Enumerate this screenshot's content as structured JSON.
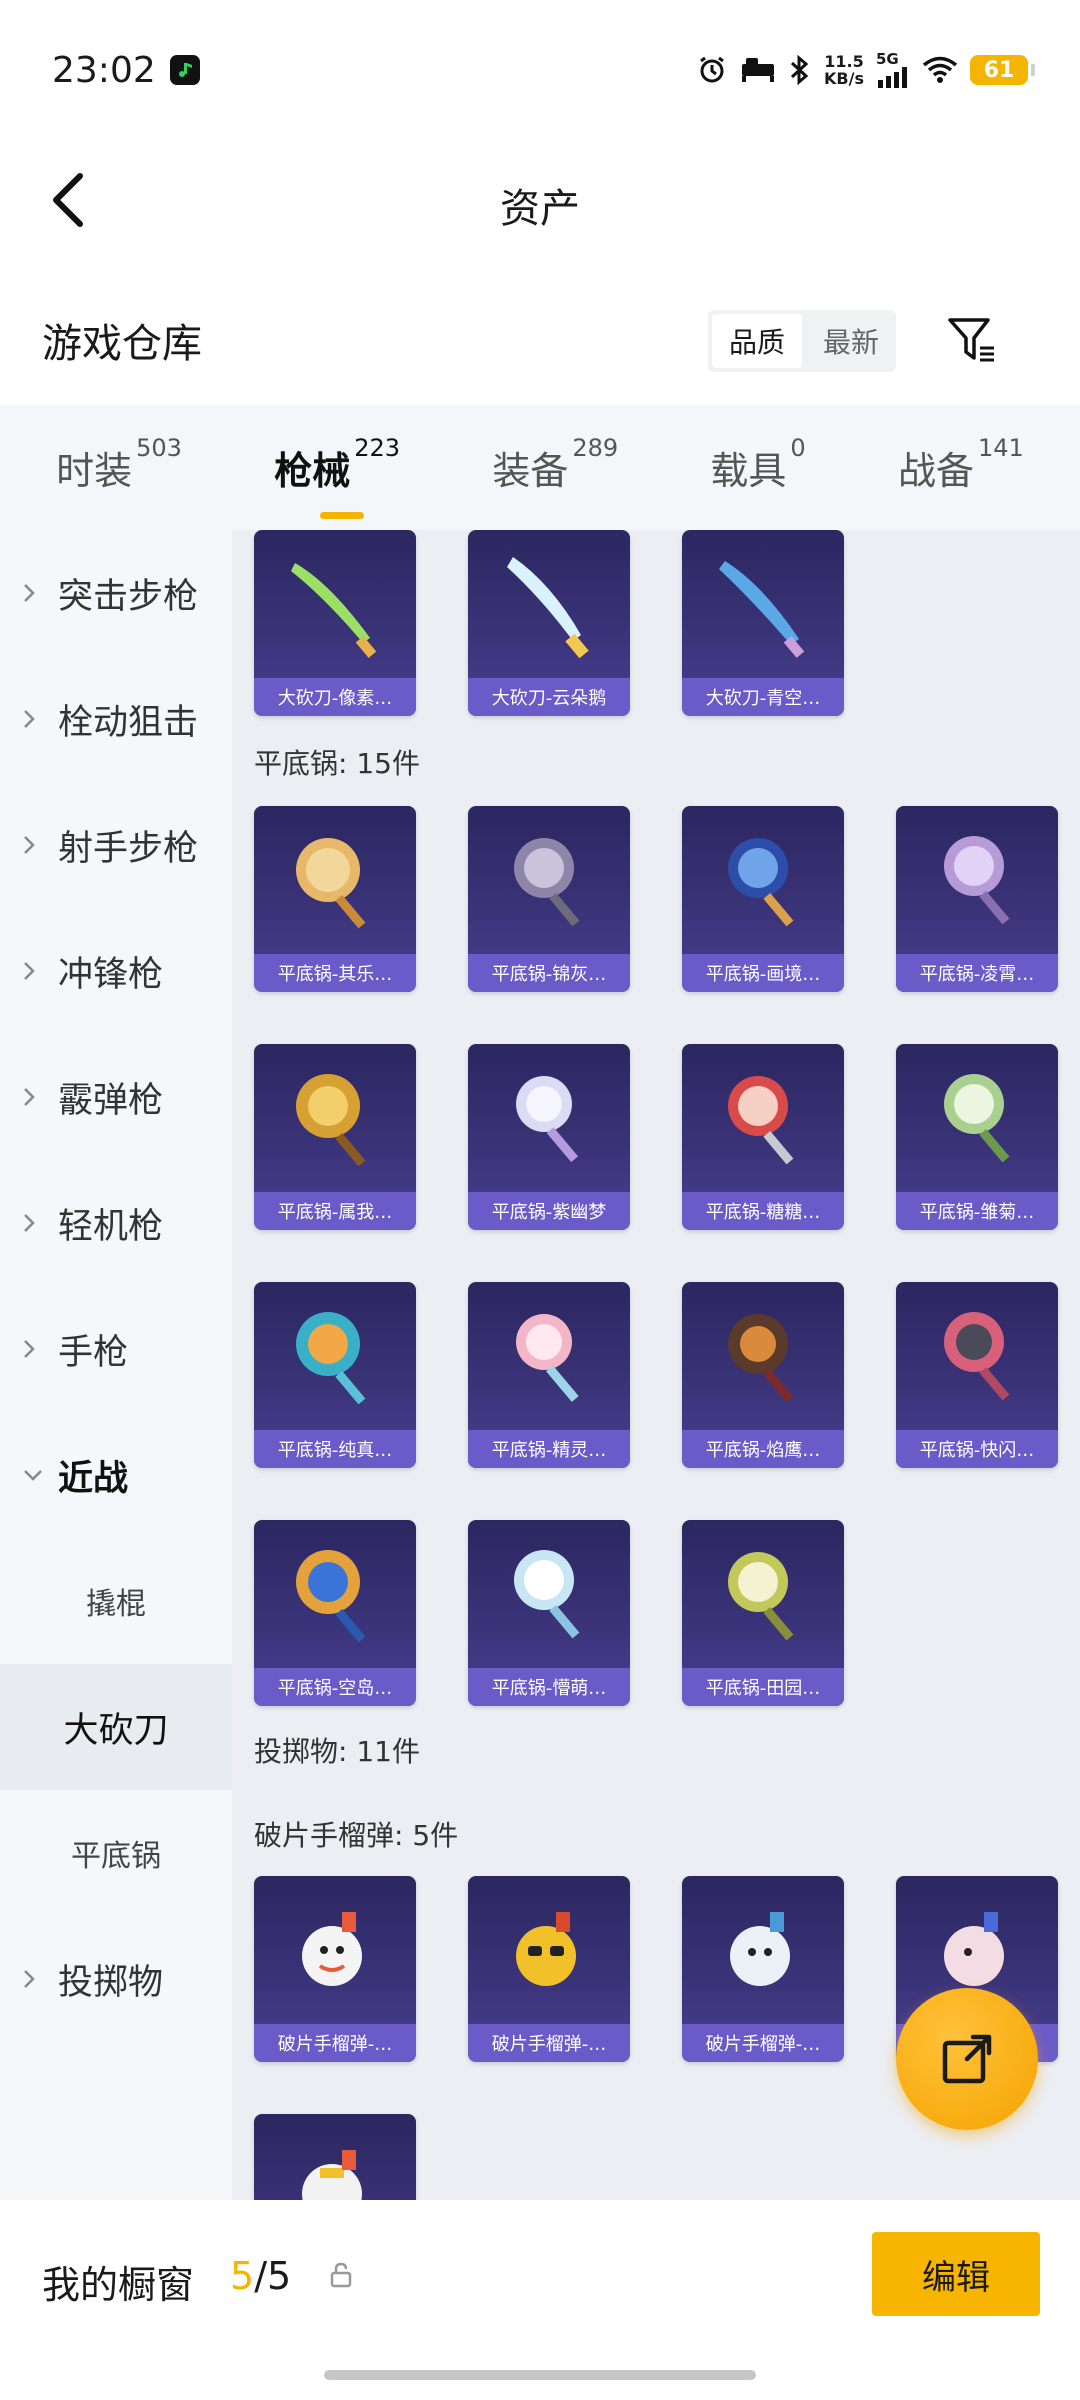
{
  "status_bar": {
    "time": "23:02",
    "net_speed_value": "11.5",
    "net_speed_unit": "KB/s",
    "network": "5G",
    "battery": "61",
    "icons": [
      "alarm-icon",
      "sleep-icon",
      "bluetooth-icon",
      "signal-icon",
      "wifi-icon"
    ]
  },
  "header": {
    "title": "资产"
  },
  "warehouse": {
    "title": "游戏仓库",
    "sort_options": [
      "品质",
      "最新"
    ],
    "active_sort": "品质"
  },
  "tabs": [
    {
      "label": "时装",
      "count": "503"
    },
    {
      "label": "枪械",
      "count": "223",
      "active": true
    },
    {
      "label": "装备",
      "count": "289"
    },
    {
      "label": "载具",
      "count": "0"
    },
    {
      "label": "战备",
      "count": "141"
    }
  ],
  "sidebar": {
    "items": [
      {
        "label": "突击步枪"
      },
      {
        "label": "栓动狙击"
      },
      {
        "label": "射手步枪"
      },
      {
        "label": "冲锋枪"
      },
      {
        "label": "霰弹枪"
      },
      {
        "label": "轻机枪"
      },
      {
        "label": "手枪"
      },
      {
        "label": "近战"
      }
    ],
    "subitems": [
      {
        "label": "撬棍"
      },
      {
        "label": "大砍刀"
      },
      {
        "label": "平底锅"
      }
    ],
    "last_item": {
      "label": "投掷物"
    }
  },
  "content": {
    "machete_items": [
      "大砍刀-像素…",
      "大砍刀-云朵鹅",
      "大砍刀-青空…"
    ],
    "pan_label": "平底锅: 15件",
    "pan_items": [
      "平底锅-其乐…",
      "平底锅-锦灰…",
      "平底锅-画境…",
      "平底锅-凌霄…",
      "平底锅-属我…",
      "平底锅-紫幽梦",
      "平底锅-糖糖…",
      "平底锅-雏菊…",
      "平底锅-纯真…",
      "平底锅-精灵…",
      "平底锅-焰鹰…",
      "平底锅-快闪…",
      "平底锅-空岛…",
      "平底锅-懵萌…",
      "平底锅-田园…"
    ],
    "throwable_label": "投掷物: 11件",
    "grenade_label": "破片手榴弹: 5件",
    "grenade_items": [
      "破片手榴弹-…",
      "破片手榴弹-…",
      "破片手榴弹-…",
      "…"
    ]
  },
  "bottom_bar": {
    "label": "我的橱窗",
    "count_current": "5",
    "count_separator": "/",
    "count_total": "5",
    "edit_label": "编辑"
  },
  "colors": {
    "accent": "#f5b400",
    "card_bg": "#3a3378",
    "card_label": "#6b5bc8"
  }
}
